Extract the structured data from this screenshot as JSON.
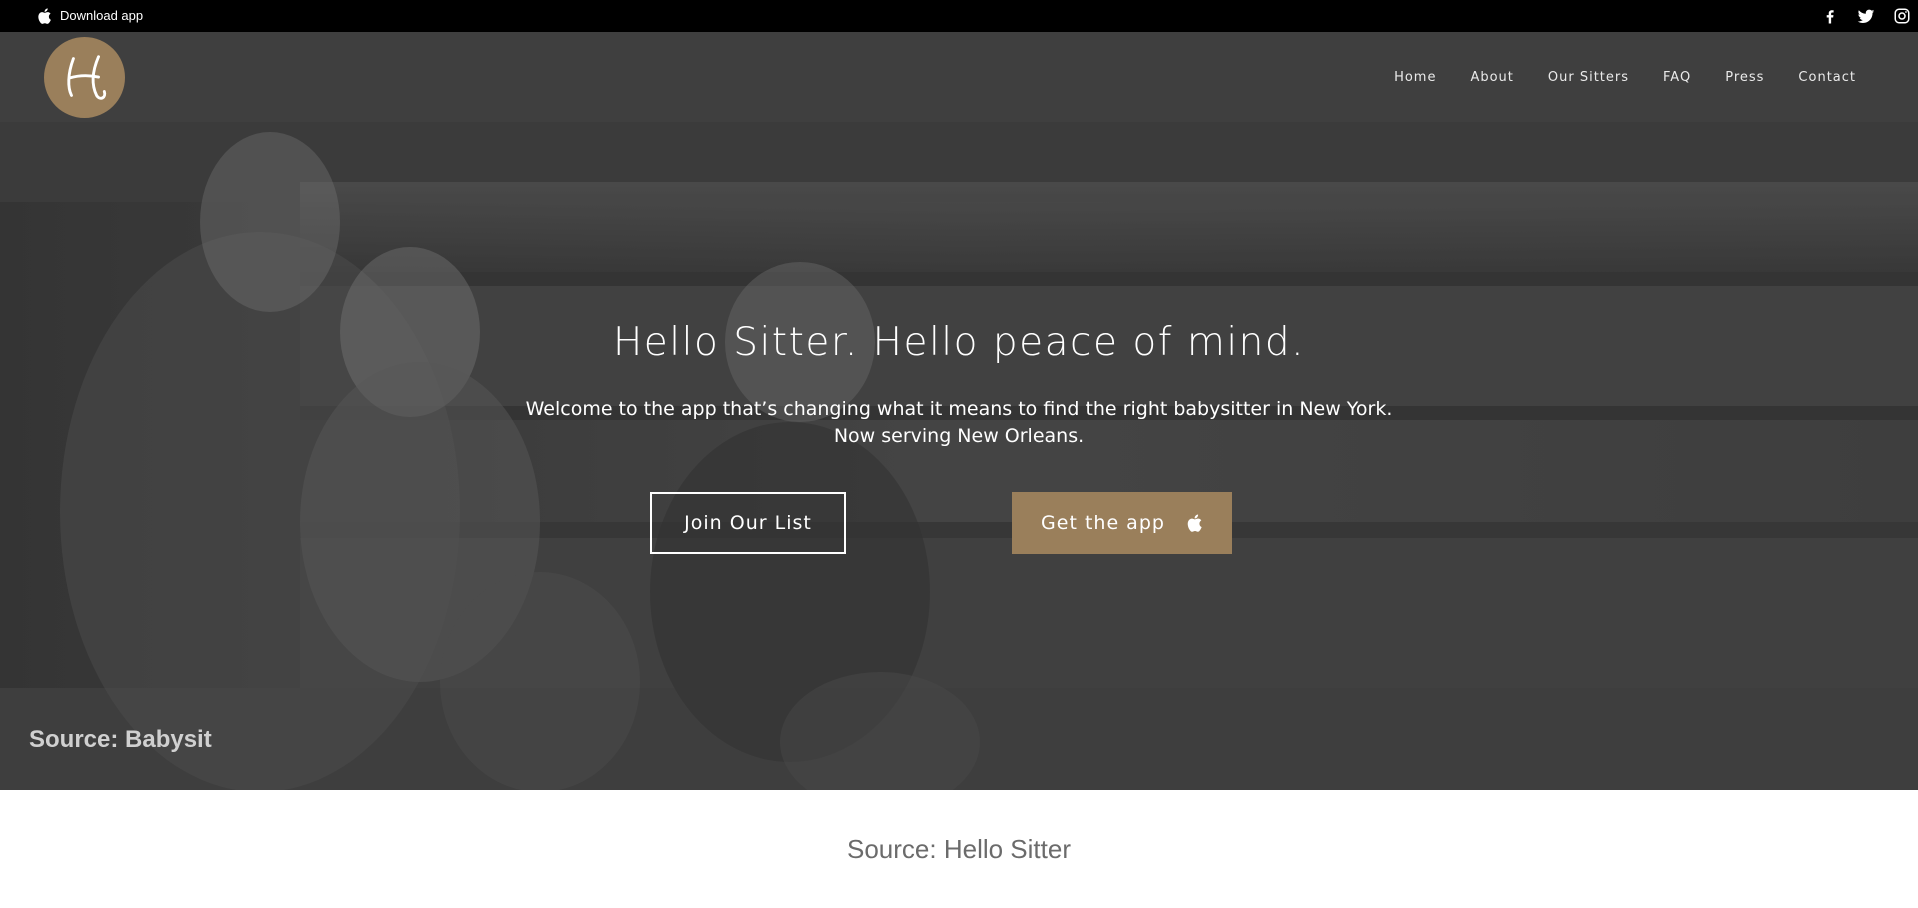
{
  "topbar": {
    "download_label": "Download app",
    "social": [
      {
        "icon": "facebook-icon"
      },
      {
        "icon": "twitter-icon"
      },
      {
        "icon": "instagram-icon"
      }
    ]
  },
  "navbar": {
    "logo": "hello-sitter-logo",
    "items": [
      {
        "label": "Home"
      },
      {
        "label": "About"
      },
      {
        "label": "Our Sitters"
      },
      {
        "label": "FAQ"
      },
      {
        "label": "Press"
      },
      {
        "label": "Contact"
      }
    ]
  },
  "hero": {
    "title": "Hello Sitter. Hello peace of mind.",
    "subtitle_line1": "Welcome to the app that’s changing what it means to find the right babysitter in New York.",
    "subtitle_line2": "Now serving New Orleans.",
    "join_label": "Join Our List",
    "app_label": "Get the app",
    "image_source": "Source: Babysit"
  },
  "caption": "Source: Hello Sitter",
  "colors": {
    "topbar_bg": "#000000",
    "navbar_bg": "#3f3f3f",
    "accent_gold": "#9a7f5b",
    "caption_text": "#6b6b6b"
  }
}
